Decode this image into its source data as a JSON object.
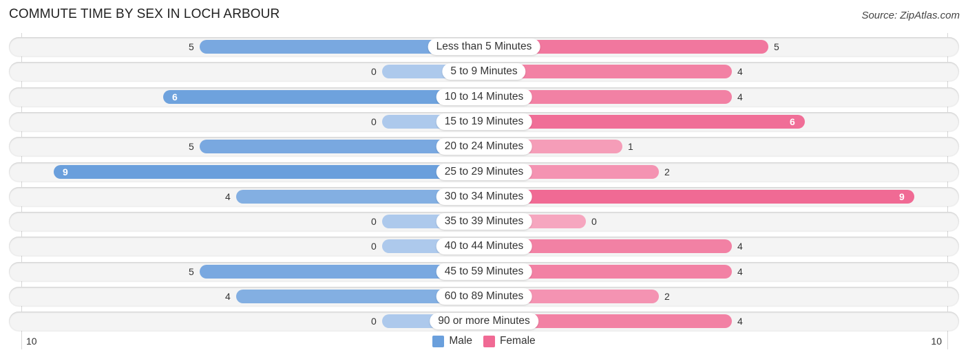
{
  "header": {
    "title": "COMMUTE TIME BY SEX IN LOCH ARBOUR",
    "source": "Source: ZipAtlas.com"
  },
  "colors": {
    "male": "#6a9fdc",
    "male_light": "#adc9ec",
    "female": "#f06a94",
    "female_light": "#f6a6bf"
  },
  "chart_data": {
    "type": "bar",
    "orientation": "horizontal-diverging",
    "title": "COMMUTE TIME BY SEX IN LOCH ARBOUR",
    "categories": [
      "Less than 5 Minutes",
      "5 to 9 Minutes",
      "10 to 14 Minutes",
      "15 to 19 Minutes",
      "20 to 24 Minutes",
      "25 to 29 Minutes",
      "30 to 34 Minutes",
      "35 to 39 Minutes",
      "40 to 44 Minutes",
      "45 to 59 Minutes",
      "60 to 89 Minutes",
      "90 or more Minutes"
    ],
    "series": [
      {
        "name": "Male",
        "values": [
          5,
          0,
          6,
          0,
          5,
          9,
          4,
          0,
          0,
          5,
          4,
          0
        ]
      },
      {
        "name": "Female",
        "values": [
          5,
          4,
          4,
          6,
          1,
          2,
          9,
          0,
          4,
          4,
          2,
          4
        ]
      }
    ],
    "axis_min_label": "10",
    "axis_max_label": "10",
    "xlim": [
      -10,
      10
    ],
    "legend": {
      "position": "bottom-center",
      "items": [
        "Male",
        "Female"
      ]
    }
  }
}
